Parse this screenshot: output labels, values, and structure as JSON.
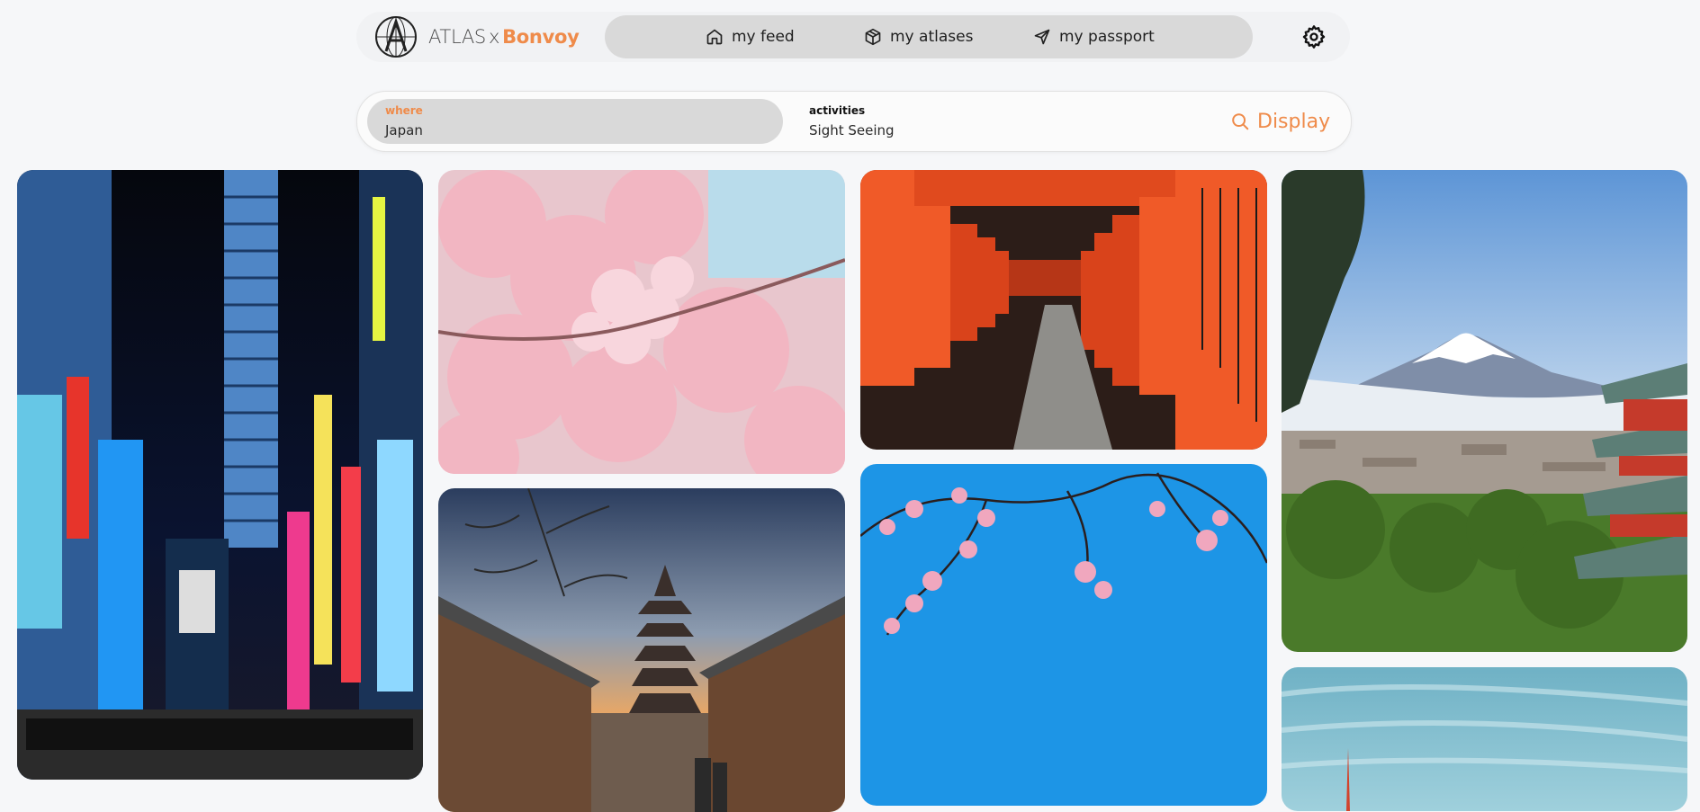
{
  "brand": {
    "name": "ATLAS",
    "separator": "x",
    "partner": "Bonvoy",
    "partner_color": "#ef8b4a"
  },
  "nav": {
    "items": [
      {
        "label": "my feed",
        "icon": "home-icon"
      },
      {
        "label": "my atlases",
        "icon": "cube-icon"
      },
      {
        "label": "my passport",
        "icon": "send-icon"
      }
    ],
    "settings_icon": "gear-icon"
  },
  "search": {
    "where_label": "where",
    "where_value": "Japan",
    "activities_label": "activities",
    "activities_value": "Sight Seeing",
    "button_label": "Display",
    "button_icon": "search-icon"
  },
  "gallery": [
    {
      "subject": "tokyo-night-street"
    },
    {
      "subject": "cherry-blossom-closeup"
    },
    {
      "subject": "fushimi-inari-torii-gates"
    },
    {
      "subject": "mount-fuji-pagoda"
    },
    {
      "subject": "kyoto-pagoda-street"
    },
    {
      "subject": "sakura-branch-blue-sky"
    },
    {
      "subject": "tokyo-tower-sky"
    }
  ]
}
